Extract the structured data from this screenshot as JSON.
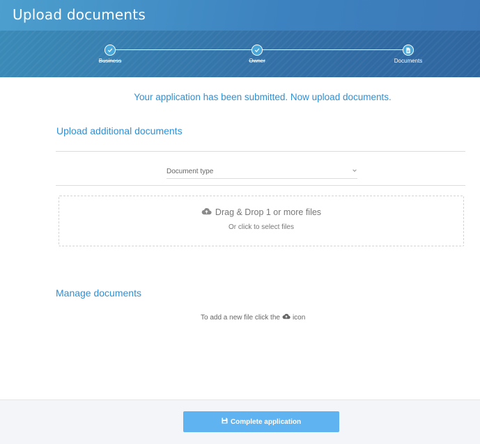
{
  "header": {
    "title": "Upload documents"
  },
  "stepper": {
    "steps": [
      {
        "label": "Business",
        "state": "done",
        "icon": "check-icon"
      },
      {
        "label": "Owner",
        "state": "done",
        "icon": "check-icon"
      },
      {
        "label": "Documents",
        "state": "active",
        "icon": "document-icon"
      }
    ]
  },
  "main": {
    "submitted_message": "Your application has been submitted. Now upload documents.",
    "upload_section": {
      "title": "Upload additional documents",
      "document_type_placeholder": "Document type",
      "dropzone": {
        "main_text": "Drag & Drop 1 or more files",
        "sub_text": "Or click to select files",
        "icon": "cloud-upload-icon"
      }
    },
    "manage_section": {
      "title": "Manage documents",
      "hint_before": "To add a new file click the",
      "hint_after": "icon"
    }
  },
  "footer": {
    "complete_label": "Complete application",
    "complete_icon": "save-icon"
  },
  "colors": {
    "accent": "#2d8fd5",
    "button": "#5fb3f0",
    "header": "#3d83c0"
  }
}
